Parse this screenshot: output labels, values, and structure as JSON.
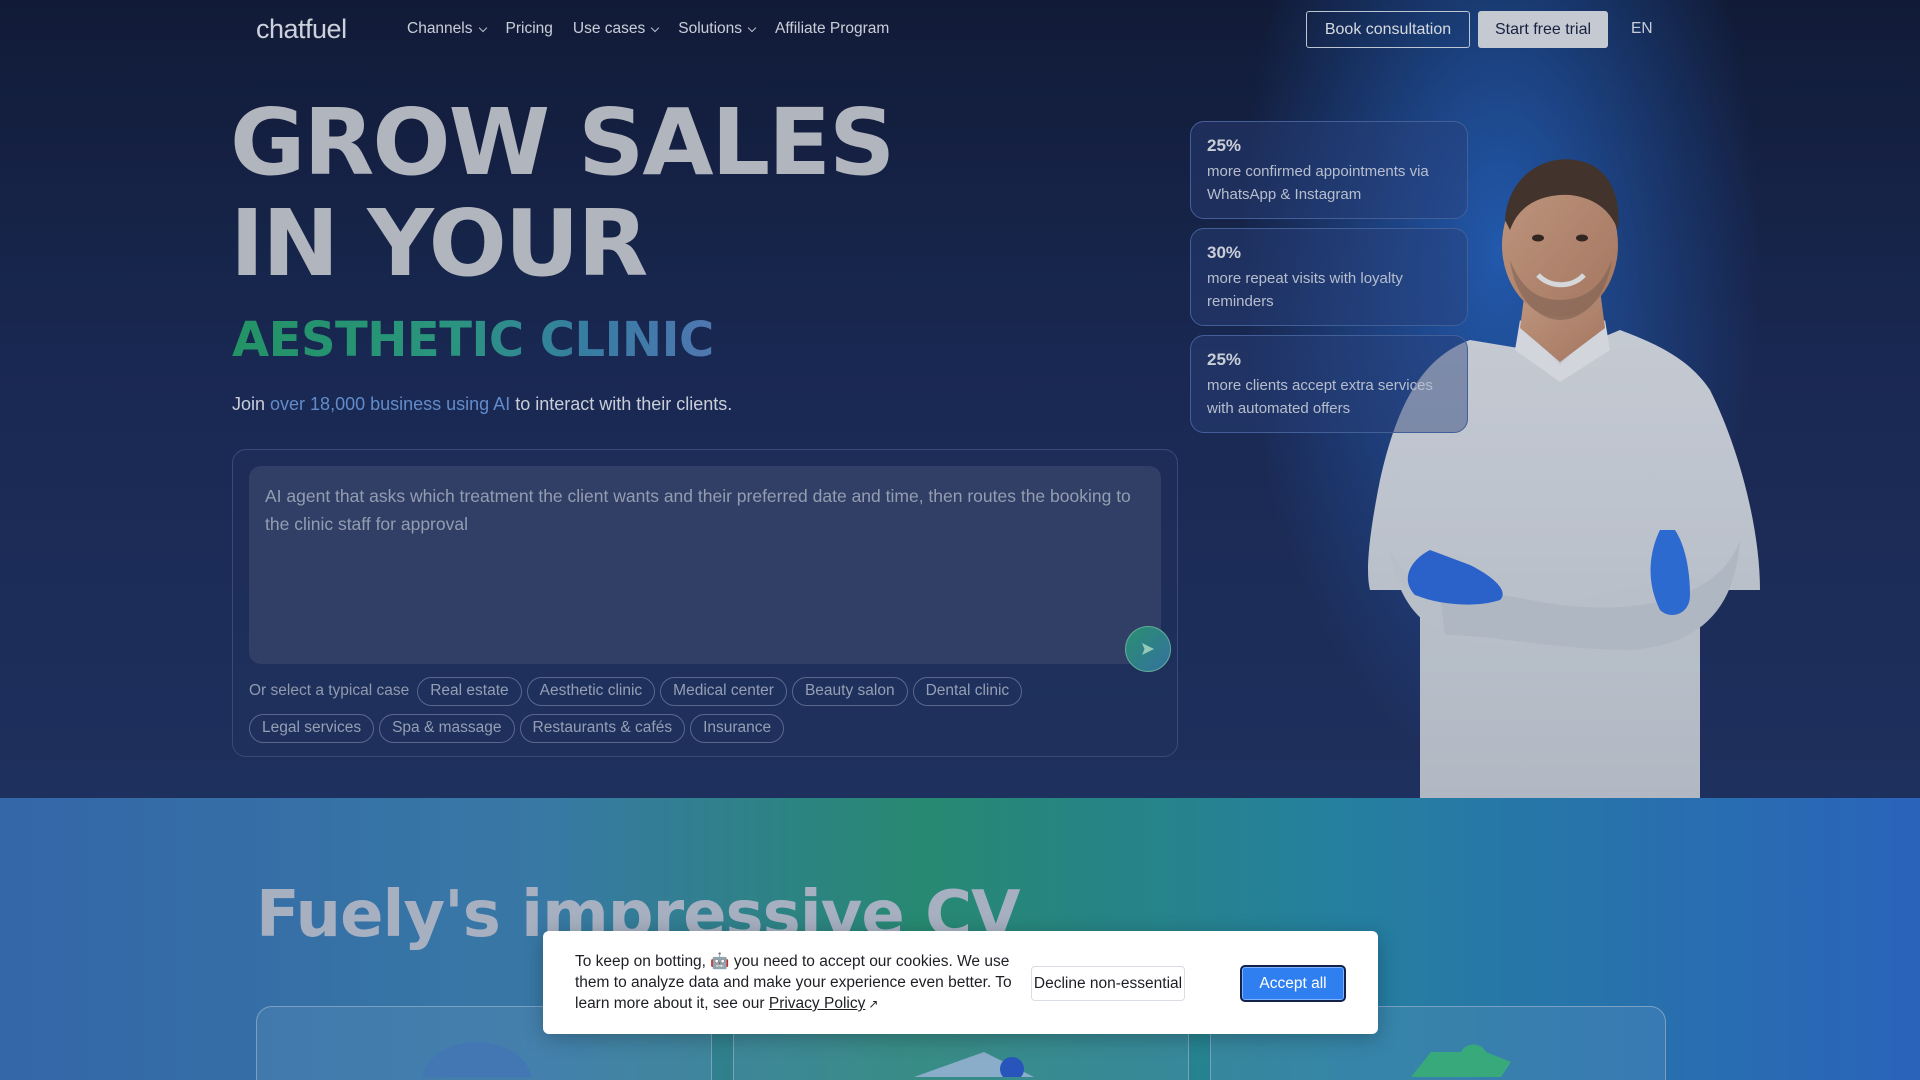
{
  "nav": {
    "logo": "chatfuel",
    "links": [
      {
        "label": "Channels",
        "has_dropdown": true
      },
      {
        "label": "Pricing",
        "has_dropdown": false
      },
      {
        "label": "Use cases",
        "has_dropdown": true
      },
      {
        "label": "Solutions",
        "has_dropdown": true
      },
      {
        "label": "Affiliate Program",
        "has_dropdown": false
      }
    ],
    "book_consultation": "Book consultation",
    "start_trial": "Start free trial",
    "language": "EN"
  },
  "hero": {
    "headline_line1": "GROW SALES",
    "headline_line2": "IN YOUR",
    "headline_accent": "AESTHETIC CLINIC",
    "sub_prefix": "Join ",
    "sub_highlight": "over 18,000 business using AI",
    "sub_suffix": " to interact with their clients."
  },
  "prompt": {
    "text": "AI agent that asks which treatment the client wants and their preferred date and time, then routes the booking to the clinic staff for approval",
    "send_icon": "send-arrow-icon",
    "select_label": "Or select a typical case",
    "cases_row1": [
      "Real estate",
      "Aesthetic clinic",
      "Medical center",
      "Beauty salon",
      "Dental clinic"
    ],
    "cases_row2": [
      "Legal services",
      "Spa & massage",
      "Restaurants & cafés",
      "Insurance"
    ]
  },
  "stats": [
    {
      "value": "25%",
      "description": "more confirmed appointments via WhatsApp & Instagram"
    },
    {
      "value": "30%",
      "description": "more repeat visits with loyalty reminders"
    },
    {
      "value": "25%",
      "description": "more clients accept extra services with automated offers"
    }
  ],
  "lower": {
    "title": "Fuely's impressive CV"
  },
  "cookie": {
    "text_before": "To keep on botting, 🤖 you need to accept our cookies. We use them to analyze data and make your experience even better. To learn more about it, see our ",
    "privacy_link": "Privacy Policy",
    "decline": "Decline non-essential",
    "accept": "Accept all"
  },
  "colors": {
    "accent_green": "#27a56e",
    "accent_blue": "#2f7ff0",
    "background": "#1c2c58"
  }
}
